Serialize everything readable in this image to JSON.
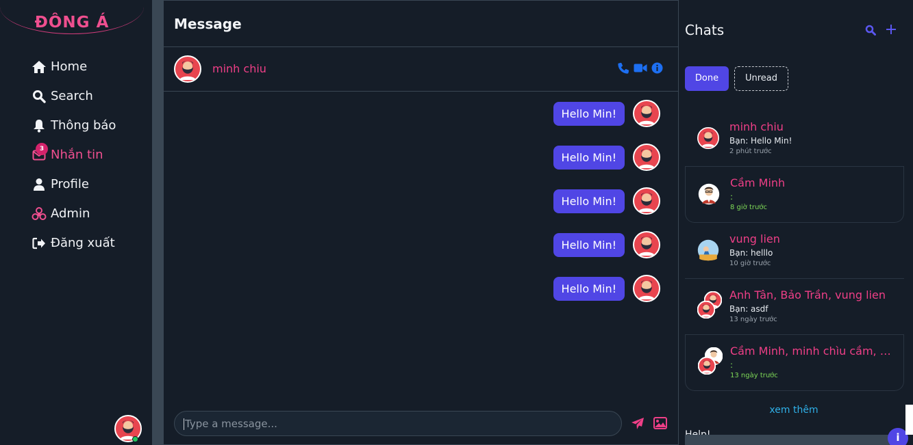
{
  "brand": {
    "name": "ĐÔNG Á",
    "accent": "#ef4f8f",
    "primary": "#5046e5"
  },
  "sidebar": {
    "items": [
      {
        "label": "Home",
        "icon": "home-icon"
      },
      {
        "label": "Search",
        "icon": "search-icon"
      },
      {
        "label": "Thông báo",
        "icon": "bell-icon"
      },
      {
        "label": "Nhắn tin",
        "icon": "envelope-icon",
        "badge": "3",
        "active": true
      },
      {
        "label": "Profile",
        "icon": "user-icon"
      },
      {
        "label": "Admin",
        "icon": "biohazard-icon"
      },
      {
        "label": "Đăng xuất",
        "icon": "logout-icon"
      }
    ]
  },
  "message": {
    "title": "Message",
    "contact_name": "minh chiu",
    "messages": [
      "Hello Min!",
      "Hello Min!",
      "Hello Min!",
      "Hello Min!",
      "Hello Min!"
    ],
    "composer_placeholder": "Type a message..."
  },
  "chats": {
    "title": "Chats",
    "filters": {
      "done": "Done",
      "unread": "Unread"
    },
    "items": [
      {
        "name": "minh chiu",
        "last": "Bạn: Hello Min!",
        "time": "2 phút trước"
      },
      {
        "name": "Cầm Minh",
        "last": ":",
        "time": "8 giờ trước"
      },
      {
        "name": "vung lien",
        "last": "Bạn: helllo",
        "time": "10 giờ trước"
      },
      {
        "name": "Anh Tân, Bảo Trần, vung lien",
        "last": "Bạn: asdf",
        "time": "13 ngày trước"
      },
      {
        "name": "Cầm Minh, minh chìu cầm, Mi...",
        "last": ":",
        "time": "13 ngày trước"
      }
    ],
    "see_more": "xem thêm",
    "help": "Help!"
  }
}
